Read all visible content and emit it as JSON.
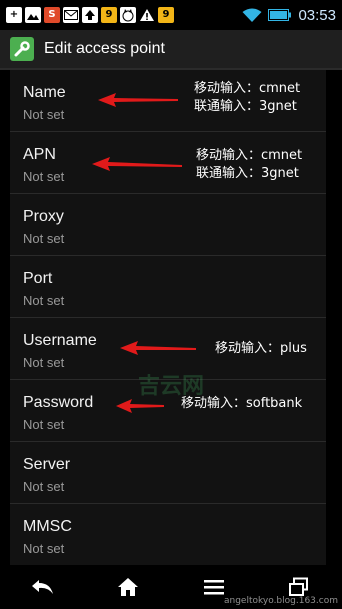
{
  "status_bar": {
    "time": "03:53",
    "icons": [
      "plus-icon",
      "image-icon",
      "s-app-icon",
      "mail-icon",
      "upload-icon",
      "app-icon",
      "cat-icon",
      "warning-icon",
      "app-icon"
    ]
  },
  "action_bar": {
    "title": "Edit access point",
    "icon": "wrench-icon"
  },
  "settings": [
    {
      "title": "Name",
      "subtitle": "Not set"
    },
    {
      "title": "APN",
      "subtitle": "Not set"
    },
    {
      "title": "Proxy",
      "subtitle": "Not set"
    },
    {
      "title": "Port",
      "subtitle": "Not set"
    },
    {
      "title": "Username",
      "subtitle": "Not set"
    },
    {
      "title": "Password",
      "subtitle": "Not set"
    },
    {
      "title": "Server",
      "subtitle": "Not set"
    },
    {
      "title": "MMSC",
      "subtitle": "Not set"
    }
  ],
  "annotations": {
    "name_line1": "移动输入：cmnet",
    "name_line2": "联通输入：3gnet",
    "apn_line1": "移动输入：cmnet",
    "apn_line2": "联通输入：3gnet",
    "username": "移动输入：plus",
    "password": "移动输入：softbank"
  },
  "nav_bar": {
    "buttons": [
      "back-icon",
      "home-icon",
      "menu-icon",
      "recent-apps-icon"
    ]
  },
  "watermarks": {
    "center": "吉云网",
    "bottom": "angeltokyo.blog.163.com"
  },
  "colors": {
    "accent": "#4caf50",
    "arrow": "#e11a1a",
    "clock": "#cfe9ff"
  }
}
